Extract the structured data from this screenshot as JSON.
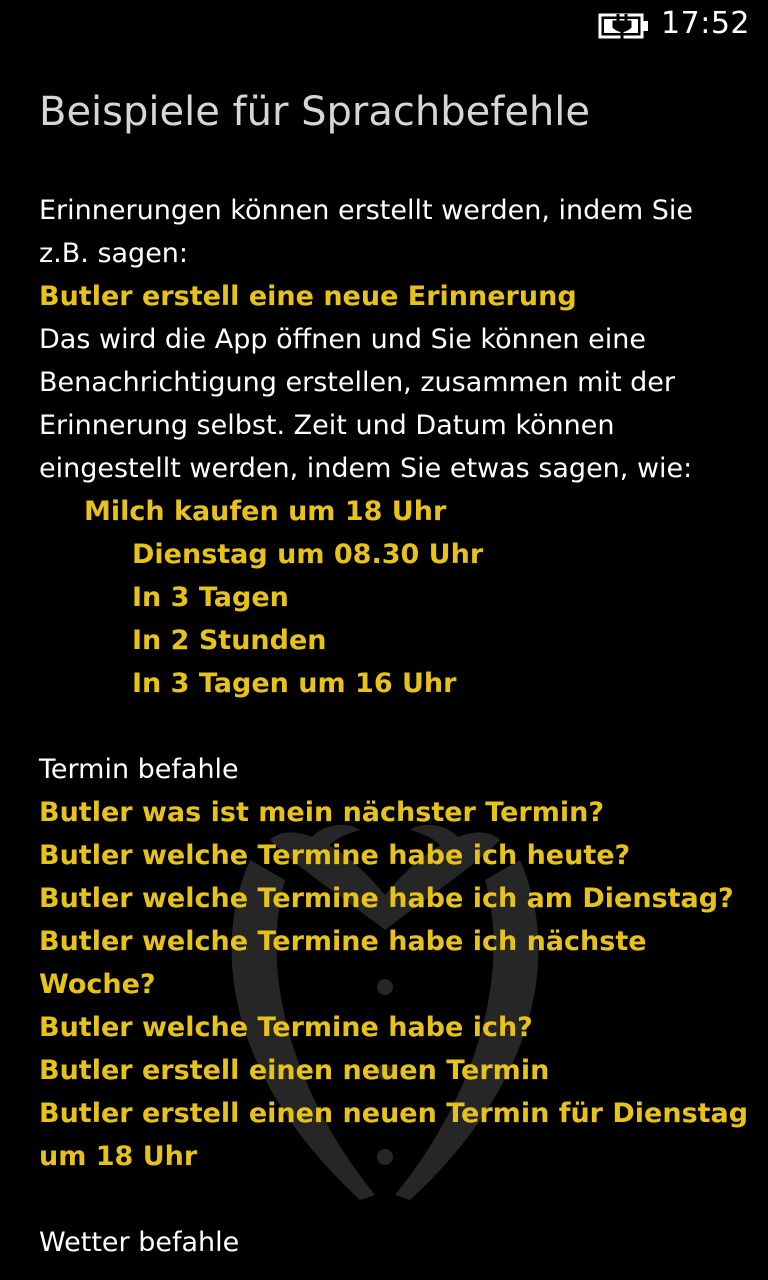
{
  "status": {
    "time": "17:52",
    "battery_icon": "battery-charging-icon"
  },
  "title": "Beispiele für Sprachbefehle",
  "colors": {
    "background": "#000000",
    "text": "#ffffff",
    "title": "#d6d6d6",
    "accent": "#e6c21a"
  },
  "reminders": {
    "intro_line1": "Erinnerungen können erstellt werden, indem Sie",
    "intro_line2": "z.B. sagen:",
    "command": "Butler erstell eine neue Erinnerung",
    "desc_line1": "Das wird die App öffnen und Sie können eine",
    "desc_line2": "Benachrichtigung erstellen, zusammen mit der",
    "desc_line3": "Erinnerung selbst. Zeit und Datum können",
    "desc_line4": "eingestellt werden, indem Sie etwas sagen, wie:",
    "example_main": "Milch kaufen um 18 Uhr",
    "examples": [
      "Dienstag um 08.30 Uhr",
      "In 3 Tagen",
      "In 2 Stunden",
      "In 3 Tagen um 16 Uhr"
    ]
  },
  "appointments": {
    "heading": "Termin befahle",
    "commands": [
      "Butler was ist mein nächster Termin?",
      "Butler welche Termine habe ich heute?",
      "Butler welche Termine habe ich am Dienstag?",
      "Butler welche Termine habe ich nächste",
      "Woche?",
      "Butler welche Termine habe ich?",
      "Butler erstell einen neuen Termin",
      "Butler erstell einen neuen Termin für Dienstag",
      "um 18 Uhr"
    ]
  },
  "weather": {
    "heading": "Wetter befahle"
  }
}
